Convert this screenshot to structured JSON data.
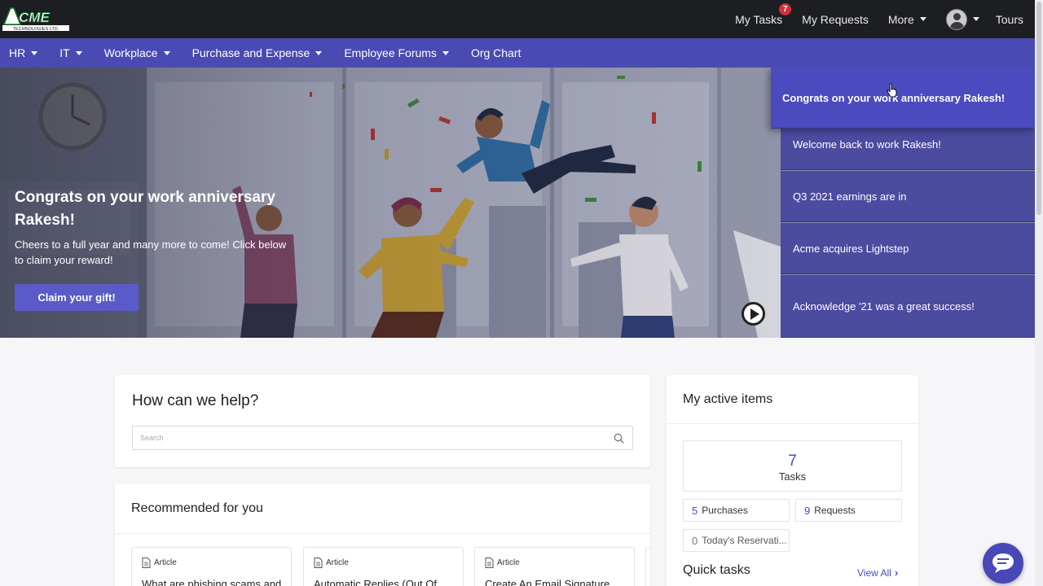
{
  "brand": {
    "logo_text": "ACME",
    "logo_subtext": "TECHNOLOGIES LTD."
  },
  "header": {
    "my_tasks": "My Tasks",
    "my_tasks_badge": "7",
    "my_requests": "My Requests",
    "more": "More",
    "tours": "Tours"
  },
  "nav": {
    "items": [
      {
        "label": "HR"
      },
      {
        "label": "IT"
      },
      {
        "label": "Workplace"
      },
      {
        "label": "Purchase and Expense"
      },
      {
        "label": "Employee Forums"
      },
      {
        "label": "Org Chart"
      }
    ]
  },
  "hero": {
    "title": "Congrats on your work anniversary Rakesh!",
    "subtitle": "Cheers to a full year and many more to come! Click below to claim your reward!",
    "cta": "Claim your gift!",
    "announcements": [
      {
        "label": "Congrats on your work anniversary Rakesh!"
      },
      {
        "label": "Welcome back to work Rakesh!"
      },
      {
        "label": "Q3 2021 earnings are in"
      },
      {
        "label": "Acme acquires Lightstep"
      },
      {
        "label": "Acknowledge '21 was a great success!"
      }
    ]
  },
  "help": {
    "title": "How can we help?",
    "search_placeholder": "Search"
  },
  "recommended": {
    "title": "Recommended for you",
    "articles": [
      {
        "type": "Article",
        "title": "What are phishing scams and"
      },
      {
        "type": "Article",
        "title": "Automatic Replies (Out Of"
      },
      {
        "type": "Article",
        "title": "Create An Email Signature"
      }
    ]
  },
  "active_items": {
    "title": "My active items",
    "tasks_count": "7",
    "tasks_label": "Tasks",
    "purchases_count": "5",
    "purchases_label": "Purchases",
    "requests_count": "9",
    "requests_label": "Requests",
    "reservations_count": "0",
    "reservations_label": "Today's Reservati...",
    "quick_tasks": "Quick tasks",
    "view_all": "View All"
  },
  "colors": {
    "topbar": "#1d1e22",
    "navbar": "#4a4ab3",
    "accent": "#3f4fbf",
    "badge": "#d22f3a"
  }
}
